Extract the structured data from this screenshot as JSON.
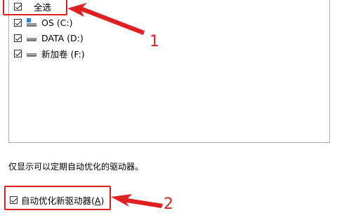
{
  "drive_list": {
    "select_all": {
      "label": "全选",
      "checked": true
    },
    "drives": [
      {
        "label": "OS (C:)",
        "checked": true,
        "icon": "windows-drive-icon"
      },
      {
        "label": "DATA (D:)",
        "checked": true,
        "icon": "drive-icon"
      },
      {
        "label": "新加卷 (F:)",
        "checked": true,
        "icon": "drive-icon"
      }
    ]
  },
  "note": "仅显示可以定期自动优化的驱动器。",
  "auto_optimize": {
    "label_prefix": "自动优化新驱动器(",
    "hotkey": "A",
    "label_suffix": ")",
    "checked": true
  },
  "annotations": {
    "callout_1": "1",
    "callout_2": "2",
    "color": "#e02020"
  }
}
